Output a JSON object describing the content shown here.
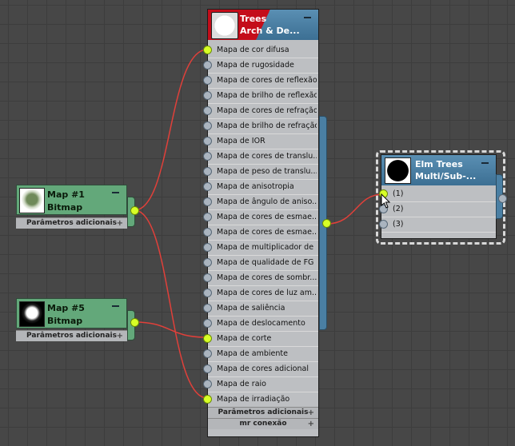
{
  "main_node": {
    "title_line1": "Trees",
    "title_line2": "Arch & De...",
    "slots": [
      {
        "label": "Mapa de cor difusa",
        "connected": true
      },
      {
        "label": "Mapa de rugosidade",
        "connected": false
      },
      {
        "label": "Mapa de cores de reflexão",
        "connected": false
      },
      {
        "label": "Mapa de brilho de reflexão",
        "connected": false
      },
      {
        "label": "Mapa de cores de refração",
        "connected": false
      },
      {
        "label": "Mapa de brilho de refração",
        "connected": false
      },
      {
        "label": "Mapa de IOR",
        "connected": false
      },
      {
        "label": "Mapa de cores de translu...",
        "connected": false
      },
      {
        "label": "Mapa de peso de translu...",
        "connected": false
      },
      {
        "label": "Mapa de anisotropia",
        "connected": false
      },
      {
        "label": "Mapa de ângulo de aniso...",
        "connected": false
      },
      {
        "label": "Mapa de cores de esmae...",
        "connected": false
      },
      {
        "label": "Mapa de cores de esmae...",
        "connected": false
      },
      {
        "label": "Mapa de multiplicador de ...",
        "connected": false
      },
      {
        "label": "Mapa de qualidade de FG",
        "connected": false
      },
      {
        "label": "Mapa de cores de sombr...",
        "connected": false
      },
      {
        "label": "Mapa de cores de luz am...",
        "connected": false
      },
      {
        "label": "Mapa de saliência",
        "connected": false
      },
      {
        "label": "Mapa de deslocamento",
        "connected": false
      },
      {
        "label": "Mapa de corte",
        "connected": true
      },
      {
        "label": "Mapa de ambiente",
        "connected": false
      },
      {
        "label": "Mapa de cores adicional",
        "connected": false
      },
      {
        "label": "Mapa de raio",
        "connected": false
      },
      {
        "label": "Mapa de irradiação",
        "connected": true
      }
    ],
    "rollout_1": "Parâmetros adicionais",
    "rollout_2": "mr conexão"
  },
  "map1": {
    "title": "Map #1",
    "subtitle": "Bitmap",
    "rollout": "Parâmetros adicionais"
  },
  "map5": {
    "title": "Map #5",
    "subtitle": "Bitmap",
    "rollout": "Parâmetros adicionais"
  },
  "multi": {
    "title_line1": "Elm Trees",
    "title_line2": "Multi/Sub-...",
    "slots": [
      "(1)",
      "(2)",
      "(3)"
    ]
  },
  "icons": [
    "minimize-icon",
    "plus-icon",
    "material-preview-icon",
    "bitmap-thumbnail-icon",
    "mouse-cursor-icon"
  ],
  "colors": {
    "background": "#474747",
    "wire": "#e0403a",
    "port_active": "#d8ff26",
    "node_header": "#4a7fa3",
    "map_node": "#63a87a"
  }
}
